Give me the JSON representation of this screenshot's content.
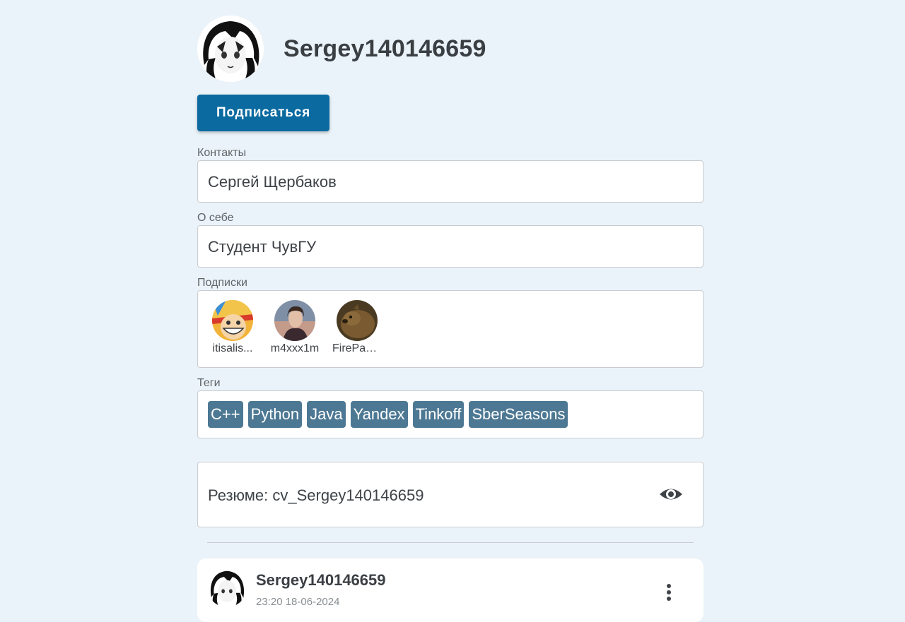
{
  "profile": {
    "username": "Sergey140146659",
    "subscribe_label": "Подписаться"
  },
  "contacts": {
    "label": "Контакты",
    "value": "Сергей Щербаков"
  },
  "about": {
    "label": "О себе",
    "value": "Студент ЧувГУ"
  },
  "subscriptions": {
    "label": "Подписки",
    "items": [
      {
        "name": "itisalis..."
      },
      {
        "name": "m4xxx1m"
      },
      {
        "name": "FirePanc..."
      }
    ]
  },
  "tags": {
    "label": "Теги",
    "items": [
      "C++",
      "Python",
      "Java",
      "Yandex",
      "Tinkoff",
      "SberSeasons"
    ]
  },
  "resume": {
    "text": "Резюме: cv_Sergey140146659",
    "view_icon": "eye-icon"
  },
  "post": {
    "author": "Sergey140146659",
    "date": "23:20 18-06-2024",
    "menu_icon": "more-vertical-icon"
  },
  "colors": {
    "background": "#eaf3f9",
    "primary_button": "#0b6aa0",
    "tag": "#4d7894"
  }
}
